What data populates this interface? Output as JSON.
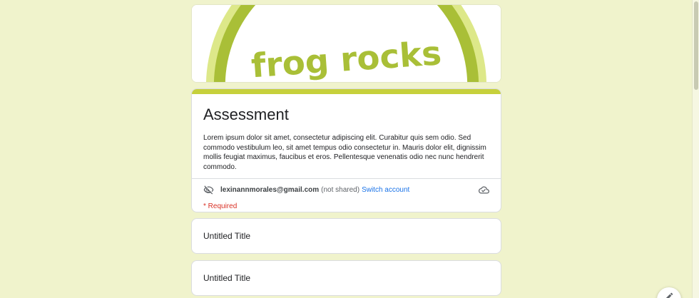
{
  "banner": {
    "text": "frog rocks"
  },
  "form": {
    "title": "Assessment",
    "description": "Lorem ipsum dolor sit amet, consectetur adipiscing elit. Curabitur quis sem odio. Sed commodo vestibulum leo, sit amet tempus odio consectetur in. Mauris dolor elit, dignissim mollis feugiat maximus, faucibus et eros. Pellentesque venenatis odio nec nunc hendrerit commodo.",
    "account": {
      "email": "lexinannmorales@gmail.com",
      "not_shared": "(not shared)",
      "switch_label": "Switch account"
    },
    "required_note": "* Required"
  },
  "questions": [
    {
      "title": "Untitled Title"
    },
    {
      "title": "Untitled Title"
    }
  ],
  "colors": {
    "background": "#f0f3cc",
    "accent": "#c6d03b",
    "link": "#1a73e8",
    "required": "#d93025"
  }
}
